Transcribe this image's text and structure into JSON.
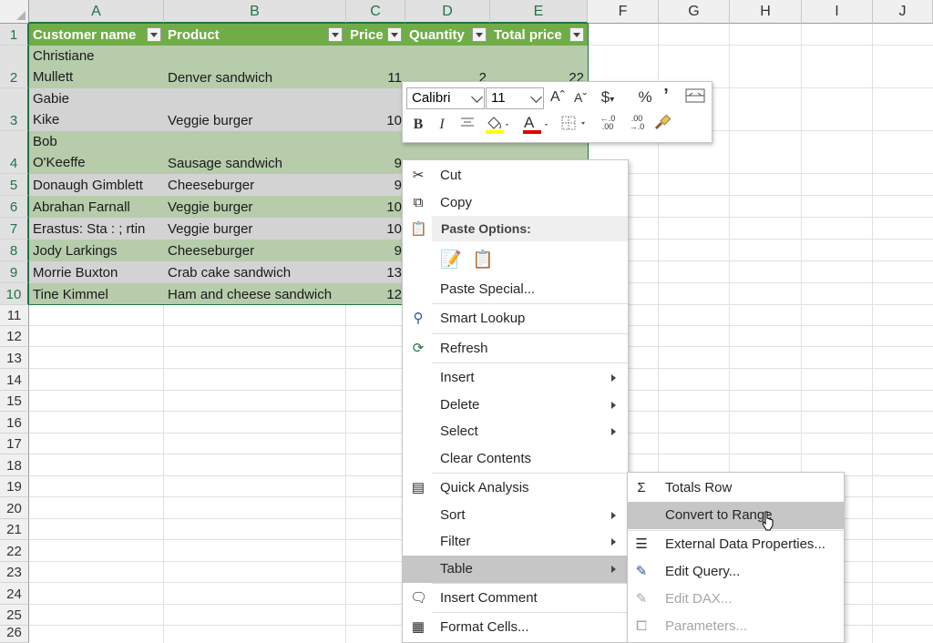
{
  "columns": [
    "A",
    "B",
    "C",
    "D",
    "E",
    "F",
    "G",
    "H",
    "I",
    "J"
  ],
  "rows": [
    "1",
    "2",
    "3",
    "4",
    "5",
    "6",
    "7",
    "8",
    "9",
    "10",
    "11",
    "12",
    "13",
    "14",
    "15",
    "16",
    "17",
    "18",
    "19",
    "20",
    "21",
    "22",
    "23",
    "24",
    "25",
    "26"
  ],
  "table": {
    "headers": [
      "Customer name",
      "Product",
      "Price",
      "Quantity",
      "Total price"
    ],
    "rows": [
      {
        "name_l1": "Christiane",
        "name_l2": "Mullett",
        "product": "Denver sandwich",
        "price": "11",
        "qty": "2",
        "total": "22"
      },
      {
        "name_l1": "Gabie",
        "name_l2": "Kike",
        "product": "Veggie burger",
        "price": "10",
        "qty": "",
        "total": ""
      },
      {
        "name_l1": "Bob",
        "name_l2": "O'Keeffe",
        "product": "Sausage sandwich",
        "price": "9",
        "qty": "",
        "total": ""
      },
      {
        "name_l1": "",
        "name_l2": "Donaugh Gimblett",
        "product": "Cheeseburger",
        "price": "9",
        "qty": "",
        "total": ""
      },
      {
        "name_l1": "",
        "name_l2": "Abrahan Farnall",
        "product": "Veggie burger",
        "price": "10",
        "qty": "",
        "total": ""
      },
      {
        "name_l1": "",
        "name_l2": "Erastus: Sta : ; rtin",
        "product": "Veggie burger",
        "price": "10",
        "qty": "",
        "total": ""
      },
      {
        "name_l1": "",
        "name_l2": "Jody Larkings",
        "product": "Cheeseburger",
        "price": "9",
        "qty": "",
        "total": ""
      },
      {
        "name_l1": "",
        "name_l2": "Morrie Buxton",
        "product": "Crab cake sandwich",
        "price": "13",
        "qty": "",
        "total": ""
      },
      {
        "name_l1": "",
        "name_l2": "Tine Kimmel",
        "product": "Ham and cheese sandwich",
        "price": "12",
        "qty": "",
        "total": ""
      }
    ]
  },
  "mini_toolbar": {
    "font": "Calibri",
    "size": "11",
    "grow": "Aˆ",
    "shrink": "Aˇ",
    "currency": "$",
    "percent": "%",
    "comma": "’",
    "bold": "B",
    "italic": "I",
    "font_color_letter": "A",
    "inc_decimal": "←.0 .00",
    "dec_decimal": ".00 →.0"
  },
  "context_menu": {
    "cut": "Cut",
    "copy": "Copy",
    "paste_options": "Paste Options:",
    "paste_special": "Paste Special...",
    "smart_lookup": "Smart Lookup",
    "refresh": "Refresh",
    "insert": "Insert",
    "delete": "Delete",
    "select": "Select",
    "clear_contents": "Clear Contents",
    "quick_analysis": "Quick Analysis",
    "sort": "Sort",
    "filter": "Filter",
    "table": "Table",
    "insert_comment": "Insert Comment",
    "format_cells": "Format Cells..."
  },
  "submenu": {
    "totals_row": "Totals Row",
    "convert_to_range": "Convert to Range",
    "external_data_properties": "External Data Properties...",
    "edit_query": "Edit Query...",
    "edit_dax": "Edit DAX...",
    "parameters": "Parameters..."
  },
  "colors": {
    "header_green": "#70ad47",
    "band_green": "#b6ccab",
    "band_gray": "#d3d3d3",
    "selection": "#217346",
    "menu_highlight": "#c6c6c6"
  }
}
